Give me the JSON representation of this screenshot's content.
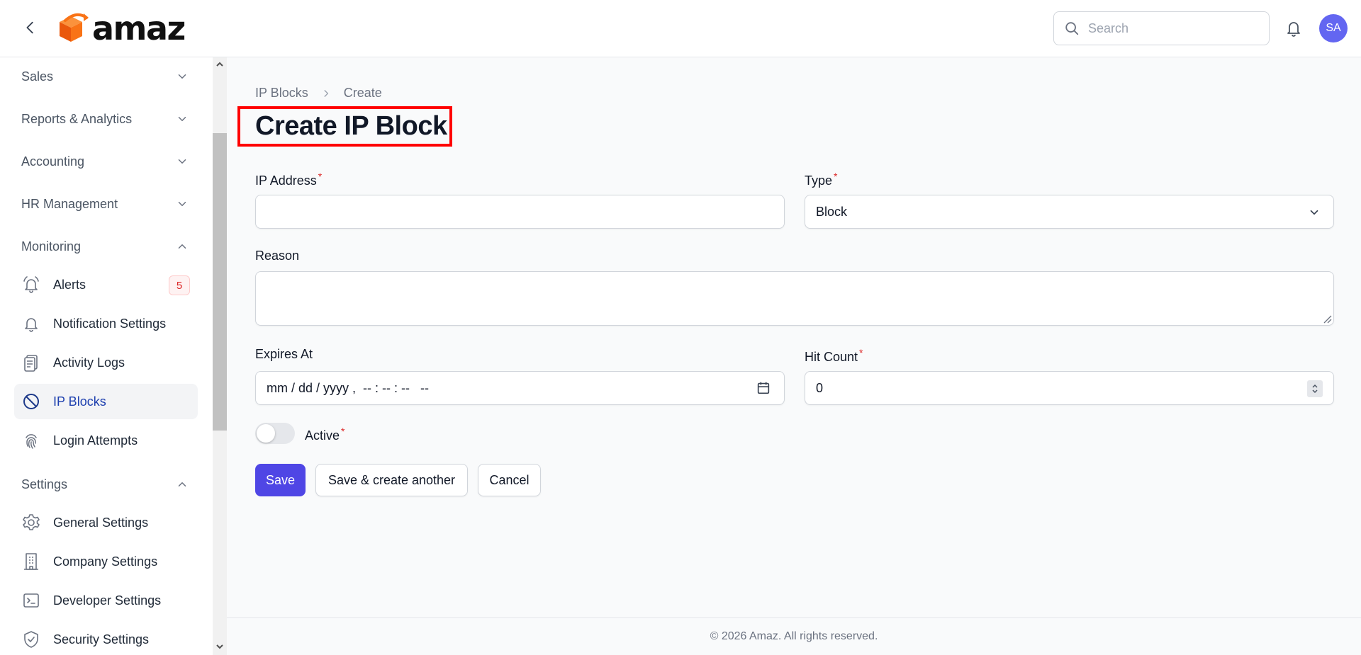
{
  "header": {
    "logo_text": "amaz",
    "search_placeholder": "Search",
    "avatar_initials": "SA",
    "colors": {
      "avatar_bg": "#6366f1",
      "logo_orange": "#f97316"
    }
  },
  "sidebar": {
    "groups": [
      {
        "label": "Sales",
        "expanded": false
      },
      {
        "label": "Reports & Analytics",
        "expanded": false
      },
      {
        "label": "Accounting",
        "expanded": false
      },
      {
        "label": "HR Management",
        "expanded": false
      },
      {
        "label": "Monitoring",
        "expanded": true
      },
      {
        "label": "Settings",
        "expanded": true
      }
    ],
    "monitoring_items": [
      {
        "label": "Alerts",
        "icon": "bell-ring-icon",
        "badge": "5"
      },
      {
        "label": "Notification Settings",
        "icon": "bell-icon"
      },
      {
        "label": "Activity Logs",
        "icon": "clipboard-list-icon"
      },
      {
        "label": "IP Blocks",
        "icon": "no-symbol-icon",
        "active": true
      },
      {
        "label": "Login Attempts",
        "icon": "fingerprint-icon"
      }
    ],
    "settings_items": [
      {
        "label": "General Settings",
        "icon": "gear-icon"
      },
      {
        "label": "Company Settings",
        "icon": "building-icon"
      },
      {
        "label": "Developer Settings",
        "icon": "terminal-icon"
      },
      {
        "label": "Security Settings",
        "icon": "shield-check-icon"
      }
    ]
  },
  "breadcrumb": {
    "parent": "IP Blocks",
    "current": "Create"
  },
  "page_title": "Create IP Block",
  "form": {
    "ip_address": {
      "label": "IP Address",
      "required": "*",
      "value": ""
    },
    "type": {
      "label": "Type",
      "required": "*",
      "value": "Block"
    },
    "reason": {
      "label": "Reason",
      "value": ""
    },
    "expires_at": {
      "label": "Expires At",
      "placeholder": "mm / dd / yyyy ,  -- : -- : --   --"
    },
    "hit_count": {
      "label": "Hit Count",
      "required": "*",
      "value": "0"
    },
    "active": {
      "label": "Active",
      "required": "*",
      "on": false
    }
  },
  "actions": {
    "save": "Save",
    "save_another": "Save & create another",
    "cancel": "Cancel"
  },
  "footer": {
    "text": "© 2026 Amaz. All rights reserved."
  },
  "colors": {
    "primary": "#4f46e5",
    "active_nav_text": "#1e40af",
    "highlight_box": "#ff0000",
    "required": "#dc2626"
  }
}
